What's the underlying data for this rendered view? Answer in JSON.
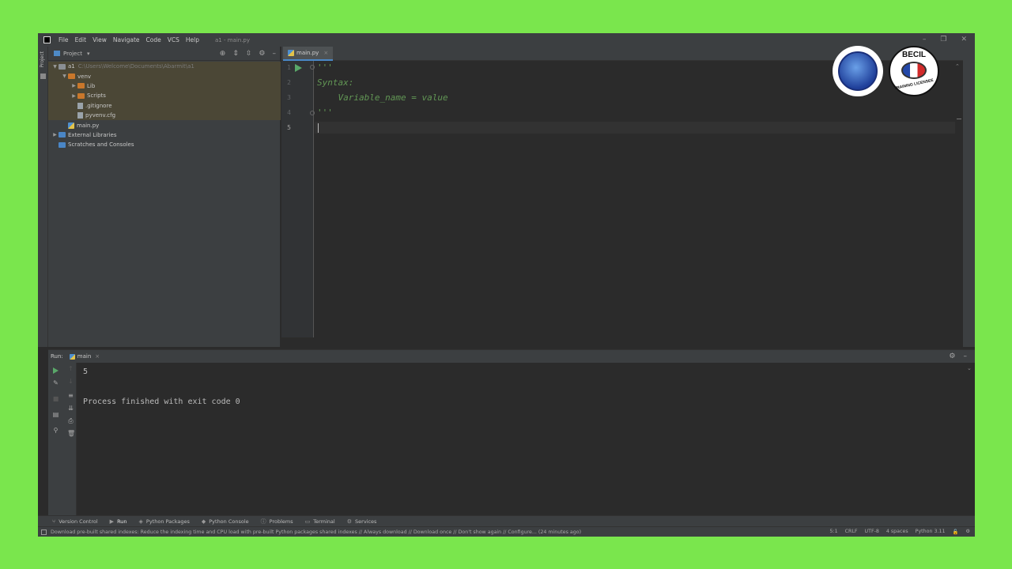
{
  "window": {
    "menu": [
      "File",
      "Edit",
      "View",
      "Navigate",
      "Code",
      "VCS",
      "Help"
    ],
    "title": "a1 - main.py",
    "controls": {
      "minimize": "–",
      "restore": "❐",
      "close": "✕"
    }
  },
  "left_stripe": {
    "label": "Project"
  },
  "project_panel": {
    "title": "Project",
    "tree": {
      "root_name": "a1",
      "root_path": "C:\\Users\\Welcome\\Documents\\Abarmit\\a1",
      "venv": "venv",
      "lib": "Lib",
      "scripts": "Scripts",
      "gitignore": ".gitignore",
      "pyvenv": "pyvenv.cfg",
      "main": "main.py",
      "external": "External Libraries",
      "scratches": "Scratches and Consoles"
    }
  },
  "editor": {
    "tab": "main.py",
    "line_numbers": [
      "1",
      "2",
      "3",
      "4",
      "5"
    ],
    "lines": [
      "'''",
      "Syntax:",
      "    Variable_name = value",
      "'''",
      ""
    ]
  },
  "logos": {
    "right_logo_text": "BECIL",
    "right_logo_sub": "TRAINING LICENSEE"
  },
  "run_panel": {
    "label": "Run:",
    "tab": "main",
    "output_line1": "5",
    "output_line2": "Process finished with exit code 0"
  },
  "tool_tabs": {
    "version_control": "Version Control",
    "run": "Run",
    "python_packages": "Python Packages",
    "python_console": "Python Console",
    "problems": "Problems",
    "terminal": "Terminal",
    "services": "Services"
  },
  "statusbar": {
    "message": "Download pre-built shared indexes: Reduce the indexing time and CPU load with pre-built Python packages shared indexes // Always download // Download once // Don't show again // Configure... (24 minutes ago)",
    "position": "5:1",
    "line_sep": "CRLF",
    "encoding": "UTF-8",
    "indent": "4 spaces",
    "interpreter": "Python 3.11"
  },
  "colors": {
    "background": "#7ae64d",
    "editor_bg": "#2b2b2b",
    "panel_bg": "#3c3f41",
    "docstring": "#629755",
    "run_green": "#59a869"
  }
}
